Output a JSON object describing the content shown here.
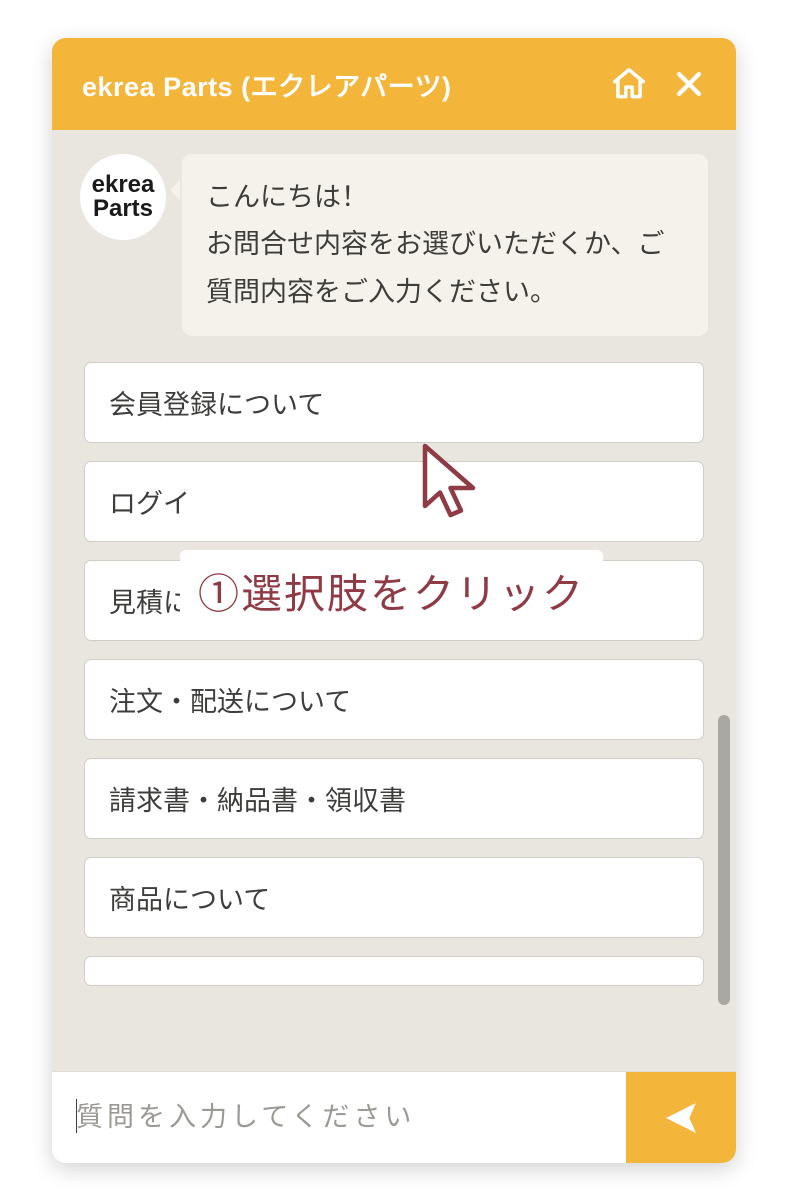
{
  "header": {
    "title": "ekrea Parts (エクレアパーツ)"
  },
  "avatar": {
    "line1": "ekrea",
    "line2": "Parts"
  },
  "greeting": "こんにちは！\nお問合せ内容をお選びいただくか、ご質問内容をご入力ください。",
  "options": [
    "会員登録について",
    "ログイ",
    "見積について",
    "注文・配送について",
    "請求書・納品書・領収書",
    "商品について"
  ],
  "input": {
    "placeholder": "質問を入力してください",
    "value": ""
  },
  "annotation": {
    "label": "①選択肢をクリック"
  },
  "colors": {
    "accent": "#f3b53a",
    "annotation": "#8f3a44"
  }
}
